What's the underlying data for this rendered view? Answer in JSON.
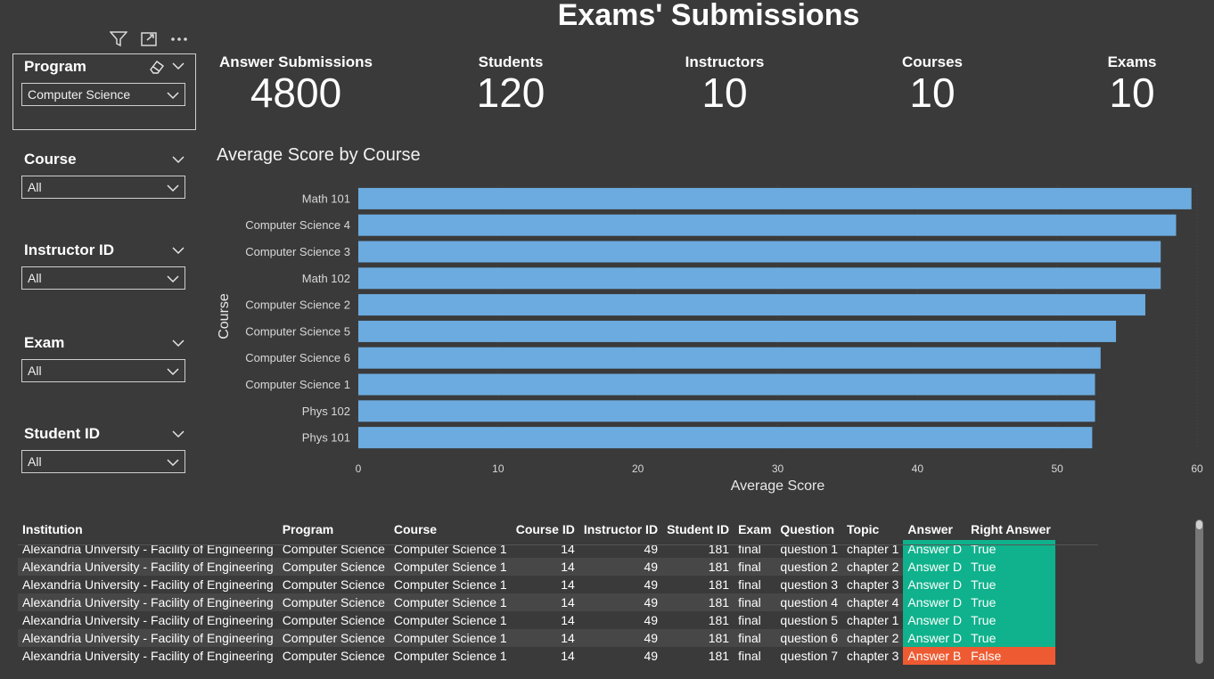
{
  "title": "Exams' Submissions",
  "top_icons": [
    "filter-icon",
    "focus-mode-icon",
    "more-options-icon"
  ],
  "slicers": [
    {
      "title": "Program",
      "value": "Computer Science"
    },
    {
      "title": "Course",
      "value": "All"
    },
    {
      "title": "Instructor ID",
      "value": "All"
    },
    {
      "title": "Exam",
      "value": "All"
    },
    {
      "title": "Student ID",
      "value": "All"
    }
  ],
  "kpis": [
    {
      "label": "Answer Submissions",
      "value": "4800"
    },
    {
      "label": "Students",
      "value": "120"
    },
    {
      "label": "Instructors",
      "value": "10"
    },
    {
      "label": "Courses",
      "value": "10"
    },
    {
      "label": "Exams",
      "value": "10"
    }
  ],
  "chart_data": {
    "type": "bar",
    "orientation": "horizontal",
    "title": "Average Score by Course",
    "xlabel": "Average Score",
    "ylabel": "Course",
    "categories": [
      "Math 101",
      "Computer Science 4",
      "Computer Science 3",
      "Math 102",
      "Computer Science 2",
      "Computer Science 5",
      "Computer Science 6",
      "Computer Science 1",
      "Phys 102",
      "Phys 101"
    ],
    "values": [
      59.6,
      58.5,
      57.4,
      57.4,
      56.3,
      54.2,
      53.1,
      52.7,
      52.7,
      52.5
    ],
    "xlim": [
      0,
      60
    ],
    "xticks": [
      "0",
      "10",
      "20",
      "30",
      "40",
      "50",
      "60"
    ],
    "bar_color": "#6cabdf",
    "grid": true
  },
  "table": {
    "columns": [
      "Institution",
      "Program",
      "Course",
      "Course ID",
      "Instructor ID",
      "Student ID",
      "Exam",
      "Question",
      "Topic",
      "Answer",
      "Right Answer"
    ],
    "rows": [
      [
        "Alexandria University - Facility of Engineering",
        "Computer Science",
        "Computer Science 1",
        "14",
        "49",
        "181",
        "final",
        "question 1",
        "chapter 1",
        "Answer D",
        "True"
      ],
      [
        "Alexandria University - Facility of Engineering",
        "Computer Science",
        "Computer Science 1",
        "14",
        "49",
        "181",
        "final",
        "question 2",
        "chapter 2",
        "Answer D",
        "True"
      ],
      [
        "Alexandria University - Facility of Engineering",
        "Computer Science",
        "Computer Science 1",
        "14",
        "49",
        "181",
        "final",
        "question 3",
        "chapter 3",
        "Answer D",
        "True"
      ],
      [
        "Alexandria University - Facility of Engineering",
        "Computer Science",
        "Computer Science 1",
        "14",
        "49",
        "181",
        "final",
        "question 4",
        "chapter 4",
        "Answer D",
        "True"
      ],
      [
        "Alexandria University - Facility of Engineering",
        "Computer Science",
        "Computer Science 1",
        "14",
        "49",
        "181",
        "final",
        "question 5",
        "chapter 1",
        "Answer D",
        "True"
      ],
      [
        "Alexandria University - Facility of Engineering",
        "Computer Science",
        "Computer Science 1",
        "14",
        "49",
        "181",
        "final",
        "question 6",
        "chapter 2",
        "Answer D",
        "True"
      ],
      [
        "Alexandria University - Facility of Engineering",
        "Computer Science",
        "Computer Science 1",
        "14",
        "49",
        "181",
        "final",
        "question 7",
        "chapter 3",
        "Answer B",
        "False"
      ]
    ],
    "colors": {
      "true": "#0fb28c",
      "false": "#ee5b32"
    }
  }
}
